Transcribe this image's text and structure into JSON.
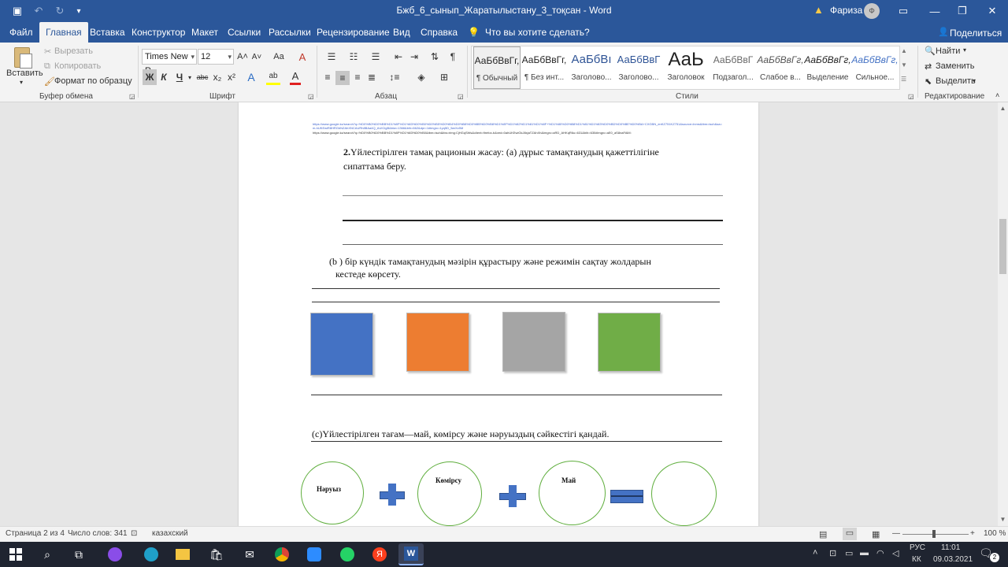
{
  "titlebar": {
    "title": "Бжб_6_сынып_Жаратылыстану_3_тоқсан  -  Word",
    "user": "Фариза",
    "avatar_initial": "Ф",
    "save_icon": "▣",
    "undo_icon": "↶",
    "redo_icon": "↻",
    "customize_icon": "▾",
    "warning_icon": "▲",
    "ribbon_display_icon": "▭",
    "minimize_icon": "—",
    "maximize_icon": "❐",
    "close_icon": "✕"
  },
  "tabs": [
    "Файл",
    "Главная",
    "Вставка",
    "Конструктор",
    "Макет",
    "Ссылки",
    "Рассылки",
    "Рецензирование",
    "Вид",
    "Справка"
  ],
  "tellme": "Что вы хотите сделать?",
  "tellme_icon": "💡",
  "share": "Поделиться",
  "share_icon": "👤",
  "ribbon": {
    "clipboard": {
      "label": "Буфер обмена",
      "paste": "Вставить",
      "cut": "Вырезать",
      "copy": "Копировать",
      "format_painter": "Формат по образцу"
    },
    "font": {
      "label": "Шрифт",
      "family": "Times New R",
      "size": "12",
      "bold": "Ж",
      "italic": "К",
      "underline": "Ч",
      "strike": "abc",
      "sub": "x₂",
      "sup": "x²",
      "grow": "A˄",
      "shrink": "A˅",
      "case": "Aa",
      "clear": "A",
      "effects": "A",
      "highlight": "ab",
      "color": "A"
    },
    "paragraph": {
      "label": "Абзац"
    },
    "styles": {
      "label": "Стили",
      "items": [
        {
          "preview": "АаБбВвГг,",
          "name": "¶ Обычный"
        },
        {
          "preview": "АаБбВвГг,",
          "name": "¶ Без инт..."
        },
        {
          "preview": "АаБбВı",
          "name": "Заголово..."
        },
        {
          "preview": "АаБбВвГ",
          "name": "Заголово..."
        },
        {
          "preview": "АаЬ",
          "name": "Заголовок"
        },
        {
          "preview": "АаБбВвГ",
          "name": "Подзагол..."
        },
        {
          "preview": "АаБбВвГг,",
          "name": "Слабое в..."
        },
        {
          "preview": "АаБбВвГг,",
          "name": "Выделение"
        },
        {
          "preview": "АаБбВвГг,",
          "name": "Сильное..."
        }
      ]
    },
    "editing": {
      "label": "Редактирование",
      "find": "Найти",
      "replace": "Заменить",
      "select": "Выделить"
    }
  },
  "document": {
    "link1": "https://www.google.kz/search?q=%D0%B0%D0%BB%D1%8F%D1%83%D0%B0%D0%B5%D0%B4%D0%B8%D0%BB%D0%B8%D1%8F%D1%82%D1%81%D1%8F+%D1%80%D0%B8%D1%81%D1%83%D0%BD%D0%BE%D0%BA+CXGBN_enKZ751KZ751&source=lnms&tbm=isch&sa=X&ved=0ahUKEwiR8",
    "link2": "m-hUKEwiR8HRGbNZAhXNCAURh8BAa4Q_AUICigB&biw=1366&bih=662&dpr=1#imgrc=1yq5D_5arXc5M",
    "link3": "https://www.google.kz/search?q=%D0%B0%D0%BB%D1%8F%D1%83%D0%B0&tbm=isch&tbs=rimg:CjHGqSWs&client=firefox-b&ved=0ahUKEwiGkJ8xjaTZAhXh&imgrc=aRD_AHKqR6u=631&bih=630#imgrc=aE0_aS8naFAlM:",
    "q2_number": "2.",
    "q2_text": "Үйлестірілген тамақ   рационын   жасау:   (а) дұрыс тамақтанудың  қажеттілігіне",
    "q2_text2": "сипаттама беру.",
    "qb_line1": "(b ) бір күндік тамақтанудың  мәзірін  құрастыру және режимін сақтау жолдарын",
    "qb_line2": "кестеде   көрсету.",
    "qc_text": "(с)Үйлестірілген  тағам—май, көмірсу және нәруыздың сәйкестігі  қандай.",
    "circle_labels": [
      "Нәруыз",
      "Көмірсу",
      "Май",
      ""
    ],
    "squares": [
      {
        "color": "#4472c4"
      },
      {
        "color": "#ed7d31"
      },
      {
        "color": "#a5a5a5"
      },
      {
        "color": "#70ad47"
      }
    ]
  },
  "statusbar": {
    "page": "Страница 2 из 4",
    "words": "Число слов: 341",
    "lang": "казахский",
    "zoom": "100 %",
    "zoom_minus": "—",
    "zoom_plus": "+"
  },
  "taskbar": {
    "lang1": "РУС",
    "lang2": "КК",
    "time": "11:01",
    "date": "09.03.2021",
    "notif": "2"
  },
  "colors": {
    "word_blue": "#2b579a",
    "taskbar": "#1f2430",
    "circle_green": "#5fae3d"
  }
}
